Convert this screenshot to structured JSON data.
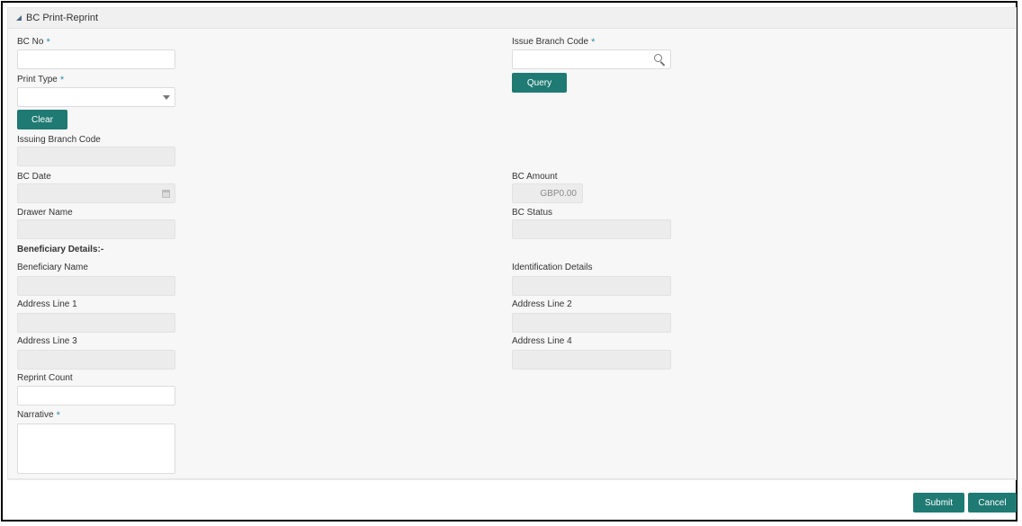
{
  "panel": {
    "title": "BC Print-Reprint"
  },
  "fields": {
    "bc_no": {
      "label": "BC No",
      "required": "*"
    },
    "issue_branch_code": {
      "label": "Issue Branch Code",
      "required": "*"
    },
    "print_type": {
      "label": "Print Type",
      "required": "*"
    },
    "issuing_branch_code": {
      "label": "Issuing Branch Code"
    },
    "bc_date": {
      "label": "BC Date"
    },
    "bc_amount": {
      "label": "BC Amount",
      "value": "GBP0.00"
    },
    "drawer_name": {
      "label": "Drawer Name"
    },
    "bc_status": {
      "label": "BC Status"
    },
    "beneficiary_name": {
      "label": "Beneficiary Name"
    },
    "identification_details": {
      "label": "Identification Details"
    },
    "address_line_1": {
      "label": "Address Line 1"
    },
    "address_line_2": {
      "label": "Address Line 2"
    },
    "address_line_3": {
      "label": "Address Line 3"
    },
    "address_line_4": {
      "label": "Address Line 4"
    },
    "reprint_count": {
      "label": "Reprint Count"
    },
    "narrative": {
      "label": "Narrative",
      "required": "*"
    }
  },
  "section": {
    "beneficiary_details": "Beneficiary Details:-"
  },
  "buttons": {
    "query": "Query",
    "clear": "Clear",
    "submit": "Submit",
    "cancel": "Cancel"
  },
  "icons": {
    "search": "search-icon",
    "dropdown": "chevron-down-icon",
    "calendar": "calendar-icon",
    "collapse": "collapse-triangle-icon"
  },
  "colors": {
    "button": "#1f7a73",
    "required_star": "#2d8fa8",
    "readonly_field": "#ececec"
  }
}
